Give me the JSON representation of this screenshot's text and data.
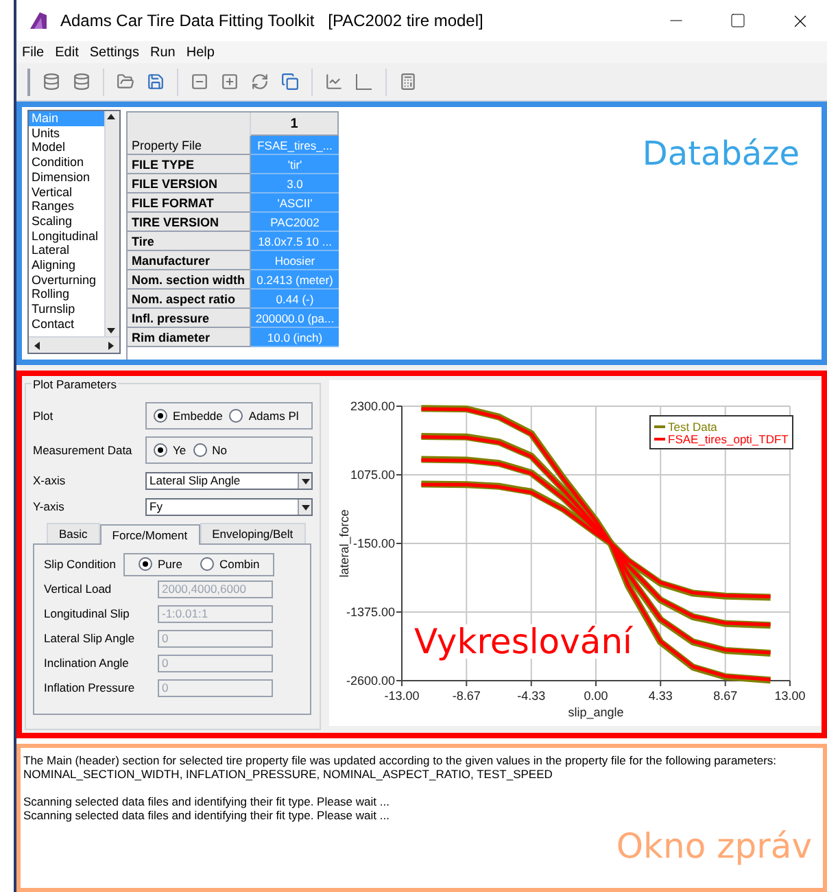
{
  "window": {
    "title": "Adams Car Tire Data Fitting Toolkit   [PAC2002 tire model]"
  },
  "menu": [
    "File",
    "Edit",
    "Settings",
    "Run",
    "Help"
  ],
  "database": {
    "annotation": "Databáze",
    "sections": [
      {
        "label": "Main",
        "selected": true
      },
      {
        "label": "Units",
        "selected": false
      },
      {
        "label": "Model",
        "selected": false
      },
      {
        "label": "Condition",
        "selected": false
      },
      {
        "label": "Dimension",
        "selected": false
      },
      {
        "label": "Vertical",
        "selected": false
      },
      {
        "label": "Ranges",
        "selected": false
      },
      {
        "label": "Scaling",
        "selected": false
      },
      {
        "label": "Longitudinal",
        "selected": false
      },
      {
        "label": "Lateral",
        "selected": false
      },
      {
        "label": "Aligning",
        "selected": false
      },
      {
        "label": "Overturning",
        "selected": false
      },
      {
        "label": "Rolling",
        "selected": false
      },
      {
        "label": "Turnslip",
        "selected": false
      },
      {
        "label": "Contact",
        "selected": false
      }
    ],
    "table": {
      "columns": [
        "1"
      ],
      "rows": [
        {
          "label": "Property File",
          "value": "FSAE_tires_...",
          "bold": false
        },
        {
          "label": "FILE TYPE",
          "value": "'tir'",
          "bold": true
        },
        {
          "label": "FILE VERSION",
          "value": "3.0",
          "bold": true
        },
        {
          "label": "FILE FORMAT",
          "value": "'ASCII'",
          "bold": true
        },
        {
          "label": "TIRE VERSION",
          "value": "PAC2002",
          "bold": true
        },
        {
          "label": "Tire",
          "value": "18.0x7.5 10 ...",
          "bold": true
        },
        {
          "label": "Manufacturer",
          "value": "Hoosier",
          "bold": true
        },
        {
          "label": "Nom. section width",
          "value": "0.2413 (meter)",
          "bold": true
        },
        {
          "label": "Nom. aspect ratio",
          "value": "0.44 (-)",
          "bold": true
        },
        {
          "label": "Infl. pressure",
          "value": "200000.0 (pa...",
          "bold": true
        },
        {
          "label": "Rim diameter",
          "value": "10.0 (inch)",
          "bold": true
        }
      ]
    }
  },
  "plot_parameters": {
    "title": "Plot Parameters",
    "radios": [
      {
        "label": "Plot",
        "options": [
          {
            "label": "Embedde",
            "selected": true
          },
          {
            "label": "Adams Pl",
            "selected": false
          }
        ]
      },
      {
        "label": "Measurement Data",
        "options": [
          {
            "label": "Ye",
            "selected": true
          },
          {
            "label": "No",
            "selected": false
          }
        ]
      }
    ],
    "selects": [
      {
        "label": "X-axis",
        "value": "Lateral Slip Angle"
      },
      {
        "label": "Y-axis",
        "value": "Fy"
      }
    ],
    "tabs": [
      {
        "label": "Basic",
        "selected": false
      },
      {
        "label": "Force/Moment",
        "selected": true
      },
      {
        "label": "Enveloping/Belt",
        "selected": false
      }
    ],
    "slip_condition": {
      "label": "Slip Condition",
      "options": [
        {
          "label": "Pure",
          "selected": true
        },
        {
          "label": "Combin",
          "selected": false
        }
      ]
    },
    "fields": [
      {
        "label": "Vertical Load",
        "value": "2000,4000,6000",
        "disabled": true
      },
      {
        "label": "Longitudinal Slip",
        "value": "-1:0.01:1",
        "disabled": true
      },
      {
        "label": "Lateral Slip Angle",
        "value": "0",
        "disabled": true
      },
      {
        "label": "Inclination Angle",
        "value": "0",
        "disabled": true
      },
      {
        "label": "Inflation Pressure",
        "value": "0",
        "disabled": true
      }
    ]
  },
  "plot": {
    "annotation": "Vykreslování",
    "chart_data": {
      "type": "line",
      "xlabel": "slip_angle",
      "ylabel": "lateral_force",
      "x": [
        -11.7,
        -8.67,
        -6.5,
        -4.33,
        -2.17,
        0,
        1,
        2.17,
        4.33,
        6.5,
        8.67,
        11.7
      ],
      "series": [
        {
          "name": "Test Data",
          "color": "#808000",
          "values": [
            2260,
            2250,
            2110,
            1810,
            1010,
            260,
            -150,
            -910,
            -1910,
            -2360,
            -2530,
            -2590
          ]
        },
        {
          "color": "#808000",
          "values": [
            1760,
            1750,
            1660,
            1410,
            810,
            160,
            -150,
            -710,
            -1510,
            -1910,
            -2060,
            -2110
          ]
        },
        {
          "color": "#808000",
          "values": [
            1350,
            1340,
            1280,
            1110,
            660,
            110,
            -150,
            -560,
            -1160,
            -1460,
            -1580,
            -1610
          ]
        },
        {
          "color": "#808000",
          "values": [
            910,
            900,
            870,
            770,
            460,
            40,
            -150,
            -460,
            -860,
            -1040,
            -1090,
            -1110
          ]
        },
        {
          "name": "FSAE_tires_opti_TDFT",
          "color": "#ff0000",
          "values": [
            2250,
            2240,
            2100,
            1800,
            1000,
            250,
            -150,
            -900,
            -1900,
            -2350,
            -2520,
            -2580
          ]
        },
        {
          "color": "#ff0000",
          "values": [
            1750,
            1740,
            1650,
            1400,
            800,
            150,
            -150,
            -700,
            -1500,
            -1900,
            -2050,
            -2100
          ]
        },
        {
          "color": "#ff0000",
          "values": [
            1340,
            1330,
            1270,
            1100,
            650,
            100,
            -150,
            -550,
            -1150,
            -1450,
            -1570,
            -1600
          ]
        },
        {
          "color": "#ff0000",
          "values": [
            900,
            900,
            860,
            760,
            450,
            30,
            -150,
            -450,
            -850,
            -1030,
            -1080,
            -1100
          ]
        }
      ],
      "grid": true,
      "legend": "upper right",
      "xlim": [
        -13,
        13
      ],
      "ylim": [
        -2600,
        2300
      ],
      "xticks": [
        {
          "value": -13,
          "label": "-13.00"
        },
        {
          "value": -8.67,
          "label": "-8.67"
        },
        {
          "value": -4.33,
          "label": "-4.33"
        },
        {
          "value": 0,
          "label": "0.00"
        },
        {
          "value": 4.33,
          "label": "4.33"
        },
        {
          "value": 8.67,
          "label": "8.67"
        },
        {
          "value": 13,
          "label": "13.00"
        }
      ],
      "yticks": [
        {
          "value": 2300,
          "label": "2300.00"
        },
        {
          "value": 1075,
          "label": "1075.00"
        },
        {
          "value": -150,
          "label": "-150.00"
        },
        {
          "value": -1375,
          "label": "-1375.00"
        },
        {
          "value": -2600,
          "label": "-2600.00"
        }
      ]
    }
  },
  "messages": {
    "annotation": "Okno zpráv",
    "paragraphs": [
      [
        "The Main (header) section for selected tire property file was updated according to the given values in the property file for the following parameters:",
        "NOMINAL_SECTION_WIDTH, INFLATION_PRESSURE, NOMINAL_ASPECT_RATIO, TEST_SPEED"
      ],
      [
        "Scanning selected data files and identifying their fit type. Please wait ...",
        "Scanning selected data files and identifying their fit type. Please wait ..."
      ]
    ]
  }
}
